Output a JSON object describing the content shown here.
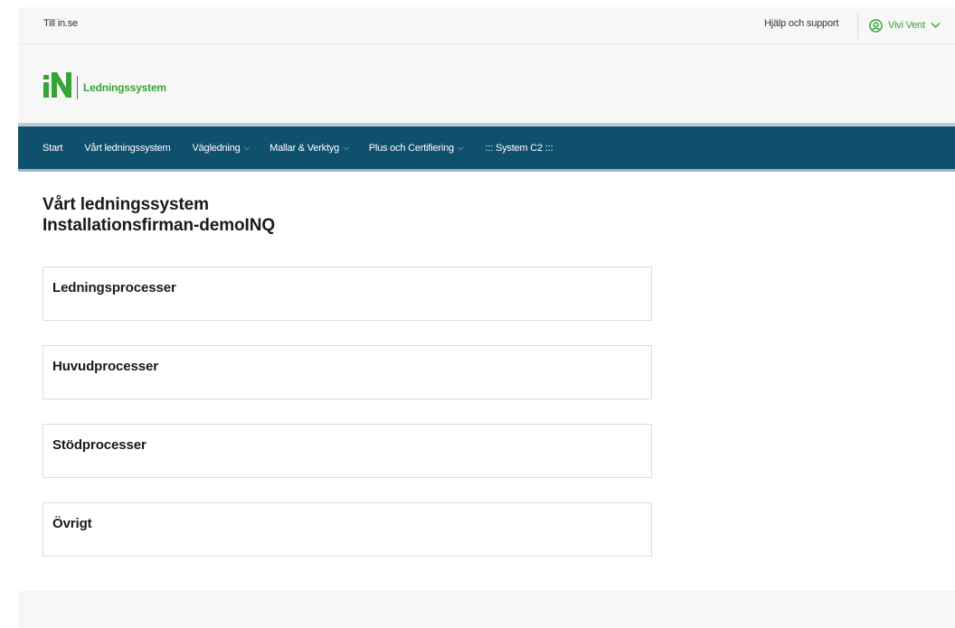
{
  "topbar": {
    "back_link": "Till in.se",
    "help_link": "Hjälp och support",
    "user_name": "Vivi Vent",
    "user_icon": "user-circle-icon",
    "user_chevron_icon": "chevron-down-icon"
  },
  "brand": {
    "logo_mark": "IN",
    "logo_text": "Ledningssystem",
    "logo_color": "#3aa335"
  },
  "nav": {
    "items": [
      {
        "label": "Start",
        "has_dropdown": false
      },
      {
        "label": "Vårt ledningssystem",
        "has_dropdown": false
      },
      {
        "label": "Vägledning",
        "has_dropdown": true
      },
      {
        "label": "Mallar & Verktyg",
        "has_dropdown": true
      },
      {
        "label": "Plus och Certifiering",
        "has_dropdown": true
      },
      {
        "label": "::: System C2 :::",
        "has_dropdown": false
      }
    ],
    "chevron": "⌵",
    "background": "#0f506d"
  },
  "page": {
    "title_line1": "Vårt ledningssystem",
    "title_line2": "Installationsfirman-demoINQ"
  },
  "sections": [
    {
      "label": "Ledningsprocesser"
    },
    {
      "label": "Huvudprocesser"
    },
    {
      "label": "Stödprocesser"
    },
    {
      "label": "Övrigt"
    }
  ]
}
